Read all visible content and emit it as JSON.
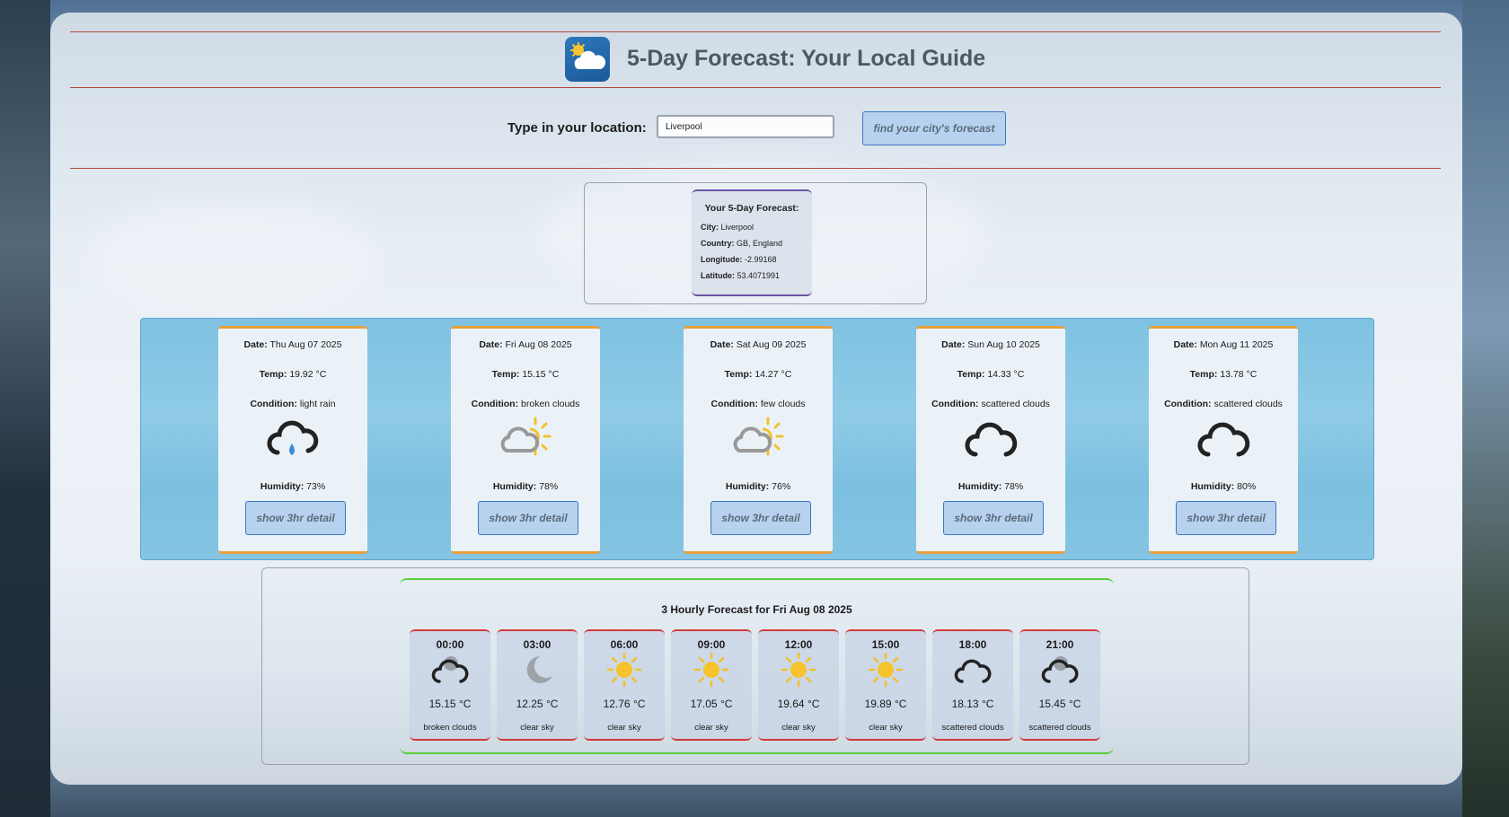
{
  "header": {
    "title": "5-Day Forecast: Your Local Guide",
    "logo_icon": "partly-cloudy-sun-icon"
  },
  "search": {
    "label": "Type in your location:",
    "value": "Liverpool",
    "button_label": "find your city's forecast"
  },
  "location_info": {
    "heading": "Your 5-Day Forecast:",
    "city_label": "City:",
    "city": "Liverpool",
    "country_label": "Country:",
    "country": "GB, England",
    "longitude_label": "Longitude:",
    "longitude": "-2.99168",
    "latitude_label": "Latitude:",
    "latitude": "53.4071991"
  },
  "labels": {
    "date": "Date:",
    "temp": "Temp:",
    "condition": "Condition:",
    "humidity": "Humidity:"
  },
  "days": [
    {
      "date": "Thu Aug 07 2025",
      "temp": "19.92 °C",
      "condition": "light rain",
      "humidity": "73%",
      "icon": "cloud-rain-icon",
      "button_label": "show 3hr detail"
    },
    {
      "date": "Fri Aug 08 2025",
      "temp": "15.15 °C",
      "condition": "broken clouds",
      "humidity": "78%",
      "icon": "cloud-sun-icon",
      "button_label": "show 3hr detail"
    },
    {
      "date": "Sat Aug 09 2025",
      "temp": "14.27 °C",
      "condition": "few clouds",
      "humidity": "76%",
      "icon": "cloud-sun-icon",
      "button_label": "show 3hr detail"
    },
    {
      "date": "Sun Aug 10 2025",
      "temp": "14.33 °C",
      "condition": "scattered clouds",
      "humidity": "78%",
      "icon": "cloud-outline-icon",
      "button_label": "show 3hr detail"
    },
    {
      "date": "Mon Aug 11 2025",
      "temp": "13.78 °C",
      "condition": "scattered clouds",
      "humidity": "80%",
      "icon": "cloud-outline-icon",
      "button_label": "show 3hr detail"
    }
  ],
  "hourly": {
    "title": "3 Hourly Forecast for Fri Aug 08 2025",
    "items": [
      {
        "time": "00:00",
        "temp": "15.15 °C",
        "condition": "broken clouds",
        "icon": "cloud-dark-icon"
      },
      {
        "time": "03:00",
        "temp": "12.25 °C",
        "condition": "clear sky",
        "icon": "moon-icon"
      },
      {
        "time": "06:00",
        "temp": "12.76 °C",
        "condition": "clear sky",
        "icon": "sun-icon"
      },
      {
        "time": "09:00",
        "temp": "17.05 °C",
        "condition": "clear sky",
        "icon": "sun-icon"
      },
      {
        "time": "12:00",
        "temp": "19.64 °C",
        "condition": "clear sky",
        "icon": "sun-icon"
      },
      {
        "time": "15:00",
        "temp": "19.89 °C",
        "condition": "clear sky",
        "icon": "sun-icon"
      },
      {
        "time": "18:00",
        "temp": "18.13 °C",
        "condition": "scattered clouds",
        "icon": "cloud-outline-icon"
      },
      {
        "time": "21:00",
        "temp": "15.45 °C",
        "condition": "scattered clouds",
        "icon": "cloud-dark-icon"
      }
    ]
  },
  "colors": {
    "header_rule": "#b04a3a",
    "day_card_border": "#e9a03a",
    "hour_card_border": "#d23a3a",
    "hourly_frame": "#58cc3a",
    "info_card_border": "#6a55a8",
    "button_bg": "#b7d2ee",
    "button_border": "#3a77c4",
    "days_band": "#7fc2e2"
  }
}
